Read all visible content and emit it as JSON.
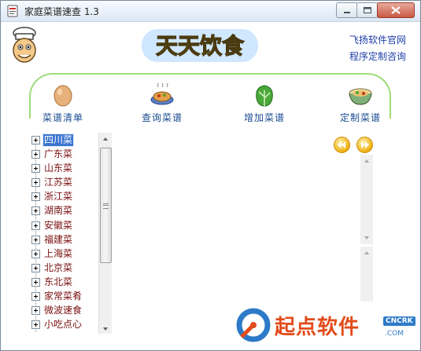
{
  "window": {
    "title": "家庭菜谱速查 1.3"
  },
  "header": {
    "banner_text": "天天饮食",
    "links": [
      "飞扬软件官网",
      "程序定制咨询"
    ]
  },
  "toolbar": {
    "items": [
      {
        "label": "菜谱清单",
        "icon": "egg-icon"
      },
      {
        "label": "查询菜谱",
        "icon": "dish-icon"
      },
      {
        "label": "增加菜谱",
        "icon": "cabbage-icon"
      },
      {
        "label": "定制菜谱",
        "icon": "noodle-bowl-icon"
      }
    ]
  },
  "tree": {
    "selected": "四川菜",
    "items": [
      "四川菜",
      "广东菜",
      "山东菜",
      "江苏菜",
      "浙江菜",
      "湖南菜",
      "安徽菜",
      "福建菜",
      "上海菜",
      "北京菜",
      "东北菜",
      "家常菜肴",
      "微波速食",
      "小吃点心"
    ]
  },
  "watermark": {
    "text": "起点软件",
    "badge": "CNCRK",
    "domain": ".COM"
  },
  "colors": {
    "accent": "#9fdc7a",
    "link": "#1f3fa8",
    "tree_text": "#7b1010",
    "selection": "#3a74d0"
  }
}
